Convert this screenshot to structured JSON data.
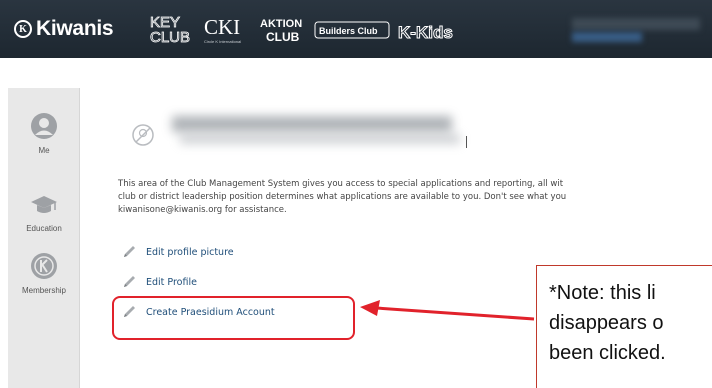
{
  "header": {
    "brand_seal": "K",
    "brand_name": "Kiwanis",
    "logos": {
      "keyclub_top": "KEY",
      "keyclub_bottom": "CLUB",
      "cki": "CKI",
      "cki_sub": "Circle K International",
      "aktion_top": "AKTION",
      "aktion_bottom": "CLUB",
      "builders": "Builders Club",
      "kkids": "K-Kids"
    }
  },
  "sidebar": {
    "items": [
      {
        "label": "Me",
        "icon": "person-icon"
      },
      {
        "label": "Education",
        "icon": "graduation-cap-icon"
      },
      {
        "label": "Membership",
        "icon": "kiwanis-seal-icon"
      }
    ]
  },
  "main": {
    "intro_lines": [
      "This area of the Club Management System gives you access to special applications and reporting, all wit",
      "club or district leadership position determines what applications are available to you. Don't see what you",
      "kiwanisone@kiwanis.org for assistance."
    ],
    "actions": [
      {
        "label": "Edit profile picture",
        "icon": "pencil-icon"
      },
      {
        "label": "Edit Profile",
        "icon": "pencil-icon"
      },
      {
        "label": "Create Praesidium Account",
        "icon": "pencil-icon"
      }
    ]
  },
  "callout": {
    "lines": [
      "*Note: this li",
      "disappears o",
      "been clicked."
    ]
  },
  "colors": {
    "header_bg": "#1d2730",
    "sidebar_bg": "#e8e8e8",
    "link": "#1f4e79",
    "highlight": "#e1222b"
  }
}
